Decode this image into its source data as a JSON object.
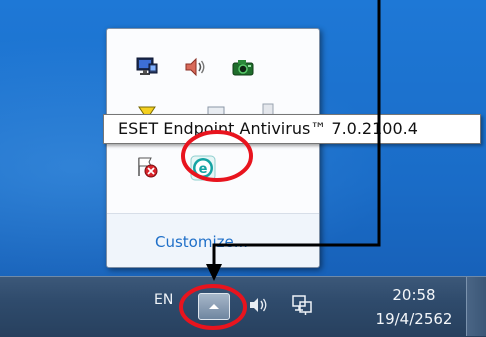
{
  "tray_popup": {
    "icons": [
      {
        "name": "network-icon"
      },
      {
        "name": "speaker-icon"
      },
      {
        "name": "camera-icon"
      },
      {
        "name": "yellow-triangle-icon"
      },
      {
        "name": "window-icon"
      },
      {
        "name": "usb-icon"
      },
      {
        "name": "action-center-error-icon"
      },
      {
        "name": "eset-icon"
      }
    ],
    "customize_label": "Customize..."
  },
  "tooltip": {
    "text": "ESET Endpoint Antivirus™ 7.0.2100.4"
  },
  "taskbar": {
    "language": "EN",
    "clock_time": "20:58",
    "clock_date": "19/4/2562"
  },
  "annotations": {
    "highlight_color": "#e8141e",
    "arrow_color": "#000000"
  }
}
